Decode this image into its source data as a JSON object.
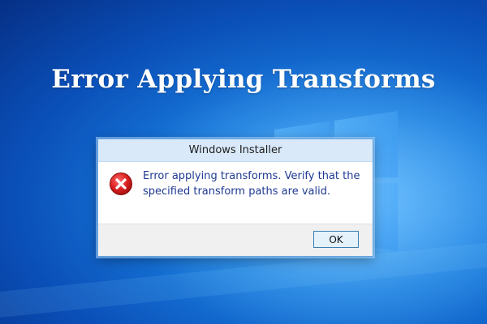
{
  "headline": "Error Applying Transforms",
  "dialog": {
    "title": "Windows Installer",
    "message": "Error applying transforms.  Verify that the\nspecified transform paths are valid.",
    "icon": "error-icon",
    "ok_label": "OK"
  },
  "colors": {
    "desktop_blue": "#1a7fe0",
    "titlebar": "#d9e9f9",
    "message_text": "#1f3a93",
    "error_red": "#d81e1e"
  }
}
